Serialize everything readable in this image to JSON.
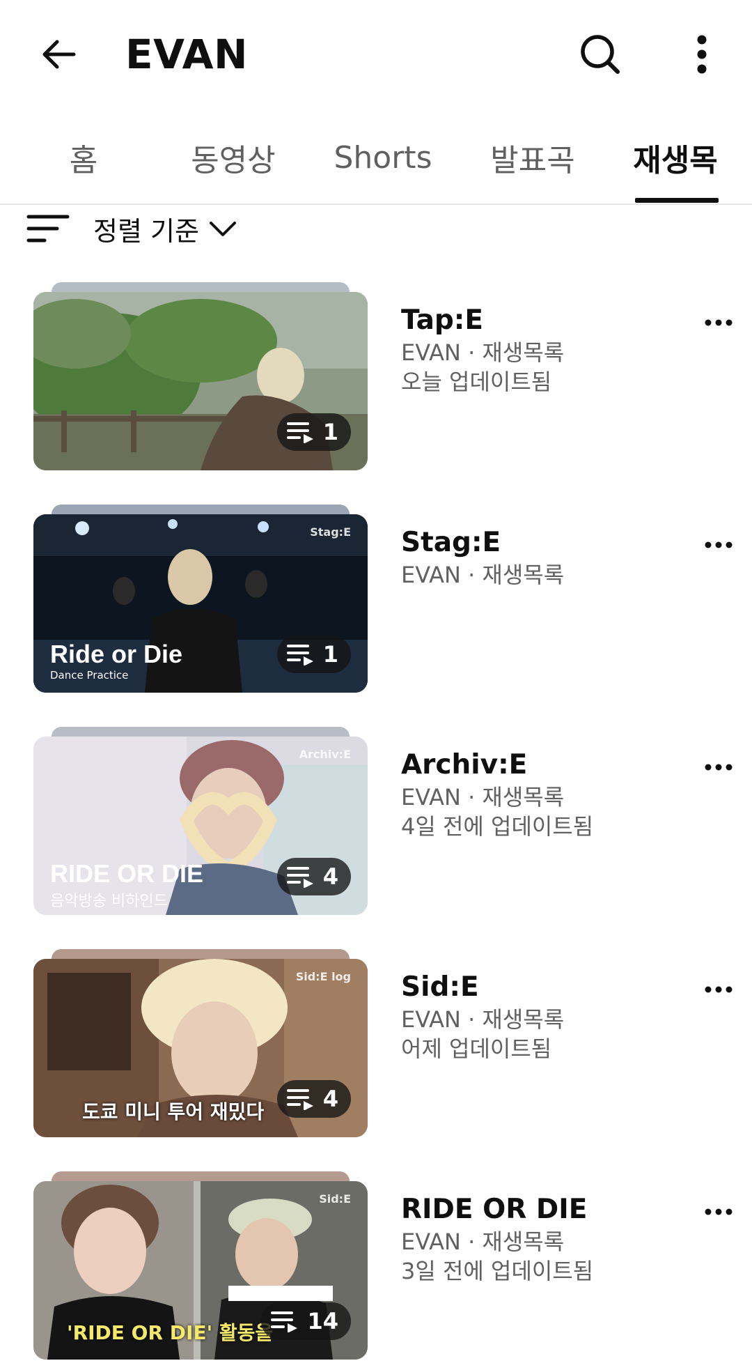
{
  "header": {
    "title": "EVAN",
    "back_icon": "arrow-left-icon",
    "search_icon": "search-icon",
    "more_icon": "more-vertical-icon"
  },
  "tabs": [
    {
      "label": "홈",
      "active": false
    },
    {
      "label": "동영상",
      "active": false
    },
    {
      "label": "Shorts",
      "active": false
    },
    {
      "label": "발표곡",
      "active": false
    },
    {
      "label": "재생목",
      "active": true
    }
  ],
  "sort": {
    "label": "정렬 기준",
    "icon": "sort-icon",
    "chevron_icon": "chevron-down-icon"
  },
  "playlists": [
    {
      "title": "Tap:E",
      "meta1": "EVAN · 재생목록",
      "meta2": "오늘 업데이트됨",
      "count": "1",
      "thumb_corner": "",
      "thumb_big": "",
      "thumb_small": "",
      "thumb_caption": ""
    },
    {
      "title": "Stag:E",
      "meta1": "EVAN · 재생목록",
      "meta2": "",
      "count": "1",
      "thumb_corner": "Stag:E",
      "thumb_big": "Ride or Die",
      "thumb_small": "Dance Practice",
      "thumb_caption": ""
    },
    {
      "title": "Archiv:E",
      "meta1": "EVAN · 재생목록",
      "meta2": "4일 전에 업데이트됨",
      "count": "4",
      "thumb_corner": "Archiv:E",
      "thumb_big": "RIDE OR DIE",
      "thumb_small": "음악방송 비하인드",
      "thumb_caption": ""
    },
    {
      "title": "Sid:E",
      "meta1": "EVAN · 재생목록",
      "meta2": "어제 업데이트됨",
      "count": "4",
      "thumb_corner": "Sid:E log",
      "thumb_big": "",
      "thumb_small": "",
      "thumb_caption": "도쿄 미니 투어 재밌다"
    },
    {
      "title": "RIDE OR DIE",
      "meta1": "EVAN · 재생목록",
      "meta2": "3일 전에 업데이트됨",
      "count": "14",
      "thumb_corner": "Sid:E",
      "thumb_big": "",
      "thumb_small": "",
      "thumb_caption": "'RIDE OR DIE' 활동을"
    }
  ],
  "colors": {
    "text_primary": "#0f0f0f",
    "text_secondary": "#606060",
    "divider": "#e5e5e5"
  }
}
